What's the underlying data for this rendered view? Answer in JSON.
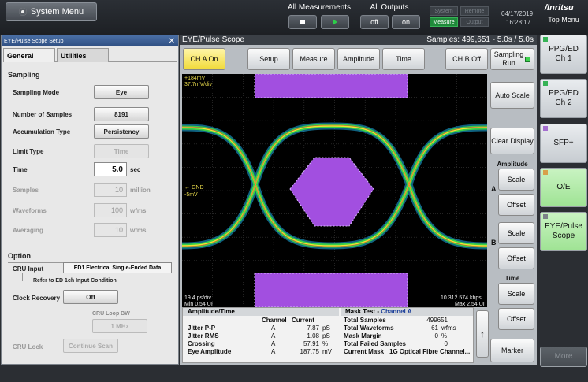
{
  "top": {
    "system_menu": "System Menu",
    "all_measurements": "All Measurements",
    "all_outputs": "All Outputs",
    "off": "off",
    "on": "on",
    "status_system": "System",
    "status_remote": "Remote",
    "status_measure": "Measure",
    "status_output": "Output",
    "date": "04/17/2019",
    "time": "16:28:17",
    "logo": "/Inritsu",
    "top_menu": "Top Menu"
  },
  "right_menu": [
    {
      "line1": "PPG/ED",
      "line2": "Ch 1",
      "tag": "green"
    },
    {
      "line1": "PPG/ED",
      "line2": "Ch 2",
      "tag": "green"
    },
    {
      "line1": "SFP+",
      "line2": "",
      "tag": "pur"
    },
    {
      "line1": "O/E",
      "line2": "",
      "tag": "org"
    },
    {
      "line1": "EYE/Pulse",
      "line2": "Scope",
      "tag": "gry"
    },
    {
      "line1": "More",
      "line2": "",
      "tag": ""
    }
  ],
  "setup": {
    "title": "EYE/Pulse Scope Setup",
    "tab_general": "General",
    "tab_utilities": "Utilities",
    "sampling_header": "Sampling",
    "sampling_mode_label": "Sampling Mode",
    "sampling_mode_value": "Eye",
    "num_samples_label": "Number of Samples",
    "num_samples_value": "8191",
    "accum_type_label": "Accumulation Type",
    "accum_type_value": "Persistency",
    "limit_type_label": "Limit Type",
    "limit_type_value": "Time",
    "time_label": "Time",
    "time_value": "5.0",
    "time_unit": "sec",
    "samples_label": "Samples",
    "samples_value": "10",
    "samples_unit": "million",
    "waveforms_label": "Waveforms",
    "waveforms_value": "100",
    "waveforms_unit": "wfms",
    "averaging_label": "Averaging",
    "averaging_value": "10",
    "averaging_unit": "wfms",
    "option_header": "Option",
    "cru_input_label": "CRU Input",
    "cru_input_value": "ED1 Electrical Single-Ended Data",
    "refer_note": "Refer to ED 1ch Input Condition",
    "clock_recovery_label": "Clock Recovery",
    "clock_recovery_value": "Off",
    "cru_loop_bw_label": "CRU Loop BW",
    "cru_loop_bw_value": "1 MHz",
    "cru_lock_label": "CRU Lock",
    "continue_scan": "Continue Scan"
  },
  "scope": {
    "title": "EYE/Pulse Scope",
    "samples_info": "Samples: 499,651 - 5.0s / 5.0s",
    "ch_a": "CH A On",
    "setup": "Setup",
    "measure": "Measure",
    "amplitude": "Amplitude",
    "time": "Time",
    "ch_b": "CH B Off",
    "sampling_line1": "Sampling",
    "sampling_line2": "Run",
    "screen_top_level": "+184mV",
    "screen_scale": "37.7mV/div",
    "screen_gnd": "GND",
    "screen_offset": "-5mV",
    "screen_time_div": "19.4 ps/div",
    "screen_min": "Min 0.54 UI",
    "screen_rate": "10.312 574 kbps",
    "screen_max": "Max 2.54 UI",
    "auto_scale": "Auto Scale",
    "clear_display": "Clear Display",
    "amplitude_lbl": "Amplitude",
    "scale": "Scale",
    "offset": "Offset",
    "a_mark": "A",
    "b_mark": "B",
    "time_lbl": "Time",
    "marker": "Marker"
  },
  "results": {
    "amp_time_header": "Amplitude/Time",
    "channel_col": "Channel",
    "current_col": "Current",
    "rows": [
      {
        "name": "Jitter P-P",
        "ch": "A",
        "val": "7.87",
        "unit": "pS"
      },
      {
        "name": "Jitter RMS",
        "ch": "A",
        "val": "1.08",
        "unit": "pS"
      },
      {
        "name": "Crossing",
        "ch": "A",
        "val": "57.91",
        "unit": "%"
      },
      {
        "name": "Eye Amplitude",
        "ch": "A",
        "val": "187.75",
        "unit": "mV"
      }
    ],
    "mask_header": "Mask Test - ",
    "mask_channel": "Channel A",
    "mask_rows": [
      {
        "name": "Total Samples",
        "val": "499651",
        "unit": ""
      },
      {
        "name": "Total Waveforms",
        "val": "61",
        "unit": "wfms"
      },
      {
        "name": "Mask Margin",
        "val": "0",
        "unit": "%"
      },
      {
        "name": "Total Failed Samples",
        "val": "0",
        "unit": ""
      }
    ],
    "current_mask_label": "Current Mask",
    "current_mask_value": "1G Optical Fibre Channel..."
  },
  "colors": {
    "mask": "#a24fe0",
    "trace_hot": "#f3e432",
    "trace_mid": "#39d04a",
    "trace_cool": "#1aa4d6"
  }
}
